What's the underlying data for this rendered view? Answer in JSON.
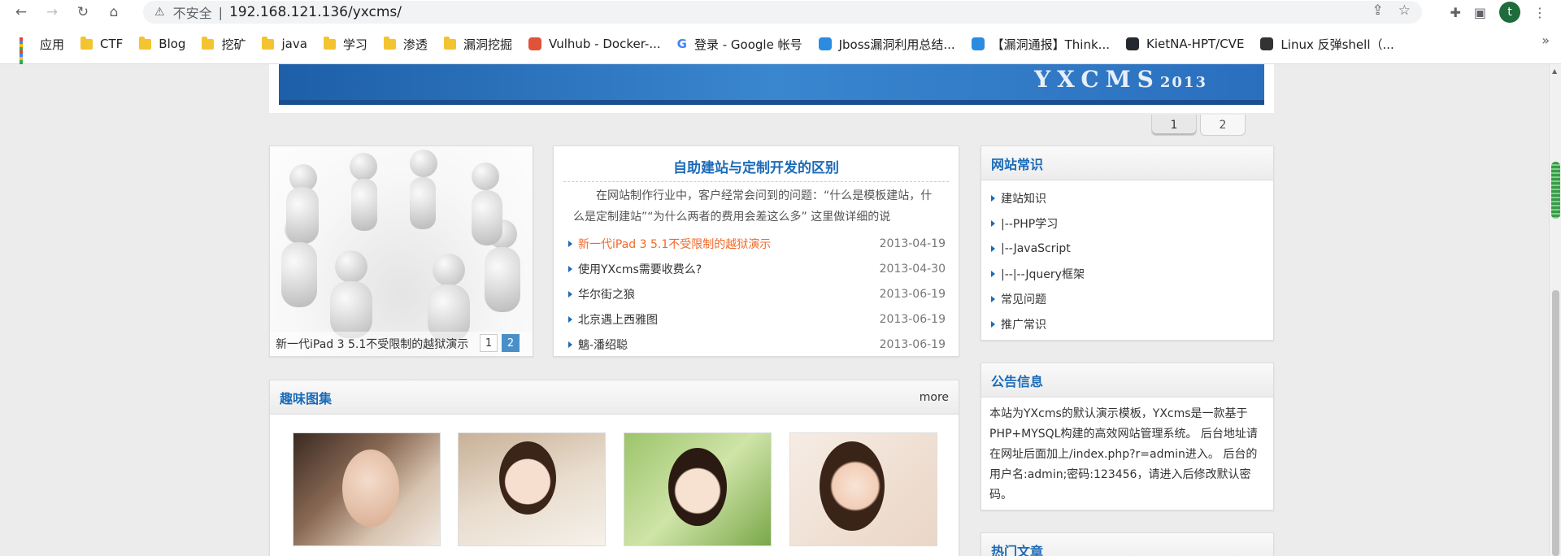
{
  "browser": {
    "security": "不安全",
    "separator": "|",
    "url": "192.168.121.136/yxcms/",
    "avatar_letter": "t"
  },
  "bookmarks": [
    {
      "label": "应用",
      "icon": "apps-grid-icon"
    },
    {
      "label": "CTF",
      "icon": "folder-icon"
    },
    {
      "label": "Blog",
      "icon": "folder-icon"
    },
    {
      "label": "挖矿",
      "icon": "folder-icon"
    },
    {
      "label": "java",
      "icon": "folder-icon"
    },
    {
      "label": "学习",
      "icon": "folder-icon"
    },
    {
      "label": "渗透",
      "icon": "folder-icon"
    },
    {
      "label": "漏洞挖掘",
      "icon": "folder-icon"
    },
    {
      "label": "Vulhub - Docker-...",
      "icon": "vulhub-icon"
    },
    {
      "label": "登录 - Google 帐号",
      "icon": "google-icon"
    },
    {
      "label": "Jboss漏洞利用总结...",
      "icon": "cloud-icon"
    },
    {
      "label": "【漏洞通报】Think...",
      "icon": "cloud-icon"
    },
    {
      "label": "KietNA-HPT/CVE",
      "icon": "github-icon"
    },
    {
      "label": "Linux 反弹shell（...",
      "icon": "notion-icon"
    }
  ],
  "banner": {
    "brand": "YXCMS",
    "year": "2013"
  },
  "slider_pager": [
    "1",
    "2"
  ],
  "photo_slider": {
    "caption": "新一代iPad 3 5.1不受限制的越狱演示",
    "pages": [
      "1",
      "2"
    ]
  },
  "news": {
    "title": "自助建站与定制开发的区别",
    "intro": "在网站制作行业中，客户经常会问到的问题：“什么是模板建站，什么是定制建站”“为什么两者的费用会差这么多” 这里做详细的说",
    "items": [
      {
        "title": "新一代iPad 3 5.1不受限制的越狱演示",
        "date": "2013-04-19"
      },
      {
        "title": "使用YXcms需要收费么?",
        "date": "2013-04-30"
      },
      {
        "title": "华尔街之狼",
        "date": "2013-06-19"
      },
      {
        "title": "北京遇上西雅图",
        "date": "2013-06-19"
      },
      {
        "title": "魑-潘绍聪",
        "date": "2013-06-19"
      }
    ]
  },
  "site_knowledge": {
    "title": "网站常识",
    "items": [
      "建站知识",
      "|--PHP学习",
      "|--JavaScript",
      "|--|--Jquery框架",
      "常见问题",
      "推广常识"
    ]
  },
  "notice": {
    "title": "公告信息",
    "text": "本站为YXcms的默认演示模板，YXcms是一款基于PHP+MYSQL构建的高效网站管理系统。 后台地址请在网址后面加上/index.php?r=admin进入。 后台的用户名:admin;密码:123456，请进入后修改默认密码。"
  },
  "hot": {
    "title": "热门文章"
  },
  "gallery": {
    "title": "趣味图集",
    "more": "more"
  }
}
